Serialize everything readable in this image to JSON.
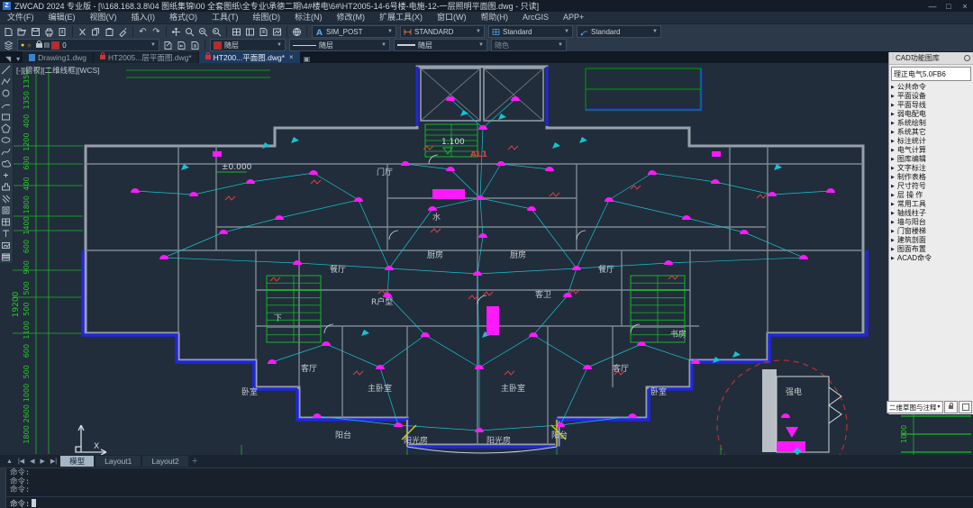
{
  "window": {
    "title": "ZWCAD 2024 专业版 - [\\\\168.168.3.8\\04 图纸集锦\\00 全套图纸\\全专业\\承德二期\\4#楼电\\6#\\HT2005-14-6号楼-电施-12-一层照明平面图.dwg - 只读]",
    "controls": {
      "minimize": "—",
      "maximize": "□",
      "close": "×"
    }
  },
  "menu": {
    "items": [
      "文件(F)",
      "编辑(E)",
      "视图(V)",
      "插入(I)",
      "格式(O)",
      "工具(T)",
      "绘图(D)",
      "标注(N)",
      "修改(M)",
      "扩展工具(X)",
      "窗口(W)",
      "帮助(H)",
      "ArcGIS",
      "APP+"
    ]
  },
  "toolbars": {
    "text_style": "SIM_POST",
    "dim_style": "STANDARD",
    "table_style": "Standard",
    "mleader_style": "Standard",
    "layer_name": "0",
    "color": "随层",
    "linetype": "随层",
    "lineweight": "随层",
    "plot_style": "随色"
  },
  "doc_tabs": [
    {
      "label": "Drawing1.dwg",
      "readonly": false,
      "active": false
    },
    {
      "label": "HT2005...层平面图.dwg*",
      "readonly": true,
      "active": false
    },
    {
      "label": "HT200...平面图.dwg*",
      "readonly": true,
      "active": true
    }
  ],
  "viewport_controls": "[-][俯视][二维线框][WCS]",
  "panel": {
    "title": "CAD功能图库",
    "library": "理正电气5.0FB6",
    "items": [
      "公共命令",
      "平面设备",
      "平面导线",
      "弱电配电",
      "系统绘制",
      "系统其它",
      "标注统计",
      "电气计算",
      "图库编辑",
      "文字标注",
      "制作表格",
      "尺寸符号",
      "层 操 作",
      "常用工具",
      "轴线柱子",
      "墙与阳台",
      "门窗楼梯",
      "建筑剖面",
      "图面布置",
      "ACAD命令"
    ],
    "workspace": "二维草图与注释"
  },
  "layout_tabs": [
    "模型",
    "Layout1",
    "Layout2"
  ],
  "command": {
    "history": [
      "命令:",
      "命令:",
      "命令:"
    ],
    "prompt": "命令:"
  },
  "drawing": {
    "levels": [
      "±0.000",
      "1.100"
    ],
    "panel_box_label": "AL1",
    "ucs_label": "X",
    "rooms": [
      "门厅",
      "餐厅",
      "厨房",
      "厨房",
      "餐厅",
      "R户型",
      "客卫",
      "主卧室",
      "主卧室",
      "卧室",
      "卧室",
      "客厅",
      "客厅",
      "阳台",
      "阳台",
      "阳光房",
      "阳光房",
      "书房",
      "强电",
      "水",
      "下"
    ],
    "dims_left": [
      "1350",
      "1350",
      "400",
      "1200",
      "600",
      "400",
      "1800",
      "1400",
      "600",
      "900",
      "500",
      "500",
      "1100",
      "600",
      "500",
      "1000",
      "2600",
      "1800"
    ],
    "dim_total": "19200",
    "dim_right": "1000",
    "colors": {
      "axis": "#1db82a",
      "device": "#ff19ff",
      "wire": "#17c3cf",
      "wall": "#98a1ab",
      "outer_wall": "#2026e0",
      "annotation": "#e04040"
    }
  }
}
